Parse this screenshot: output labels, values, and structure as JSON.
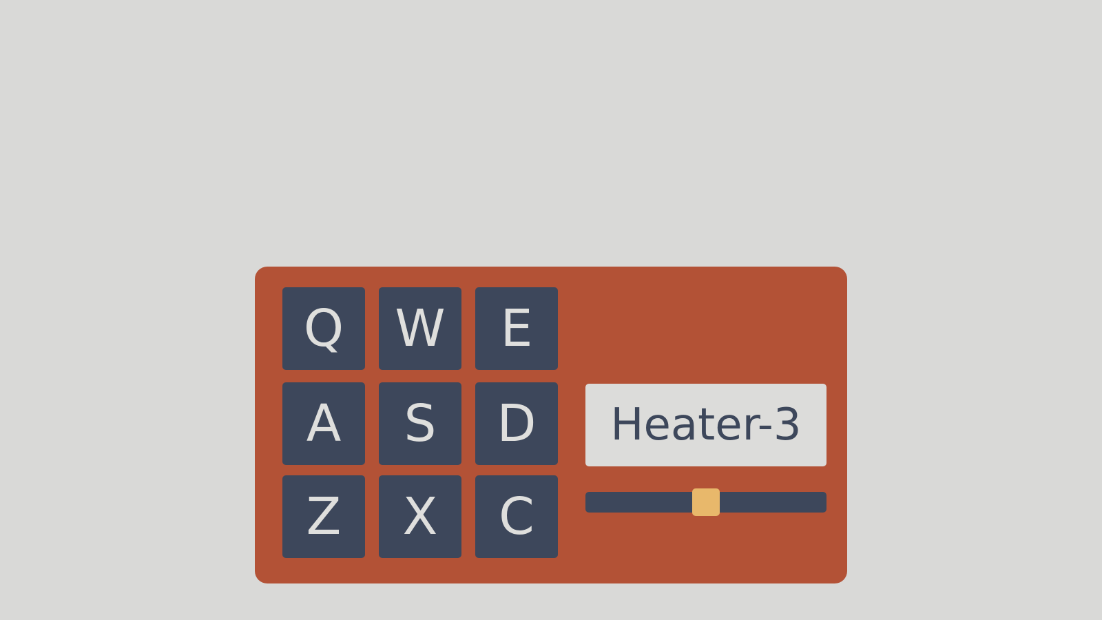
{
  "keypad": {
    "keys": [
      "Q",
      "W",
      "E",
      "A",
      "S",
      "D",
      "Z",
      "X",
      "C"
    ]
  },
  "display": {
    "label": "Heater-3"
  },
  "slider": {
    "value_fraction": 0.5
  },
  "colors": {
    "background": "#d9d9d7",
    "panel": "#b35236",
    "key": "#3d475b",
    "key_text": "#dfdfdd",
    "display_bg": "#dcdcda",
    "display_text": "#3d475b",
    "slider_thumb": "#e8b86b"
  }
}
